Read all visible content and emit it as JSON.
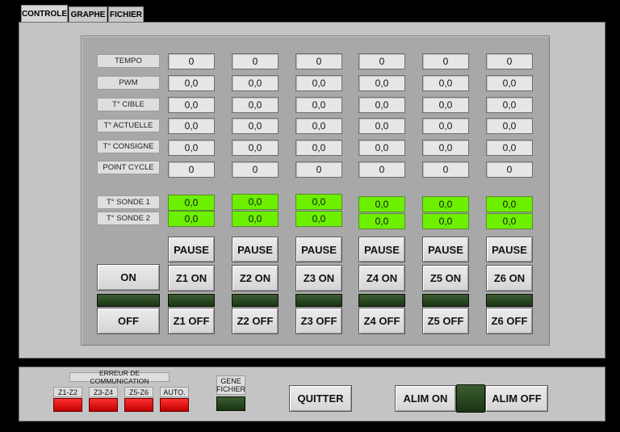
{
  "tabs": [
    {
      "label": "CONTROLE",
      "active": true
    },
    {
      "label": "GRAPHE"
    },
    {
      "label": "FICHIER"
    }
  ],
  "row_labels": [
    "TEMPO",
    "PWM",
    "T° CIBLE",
    "T° ACTUELLE",
    "T° CONSIGNE",
    "POINT CYCLE",
    "T° SONDE 1",
    "T° SONDE 2"
  ],
  "zones": [
    {
      "tempo": "0",
      "pwm": "0,0",
      "cible": "0,0",
      "actuelle": "0,0",
      "consigne": "0,0",
      "cycle": "0",
      "sonde1": "0,0",
      "sonde2": "0,0",
      "pause": "PAUSE",
      "on": "Z1 ON",
      "off": "Z1 OFF"
    },
    {
      "tempo": "0",
      "pwm": "0,0",
      "cible": "0,0",
      "actuelle": "0,0",
      "consigne": "0,0",
      "cycle": "0",
      "sonde1": "0,0",
      "sonde2": "0,0",
      "pause": "PAUSE",
      "on": "Z2 ON",
      "off": "Z2 OFF"
    },
    {
      "tempo": "0",
      "pwm": "0,0",
      "cible": "0,0",
      "actuelle": "0,0",
      "consigne": "0,0",
      "cycle": "0",
      "sonde1": "0,0",
      "sonde2": "0,0",
      "pause": "PAUSE",
      "on": "Z3 ON",
      "off": "Z3 OFF"
    },
    {
      "tempo": "0",
      "pwm": "0,0",
      "cible": "0,0",
      "actuelle": "0,0",
      "consigne": "0,0",
      "cycle": "0",
      "sonde1": "0,0",
      "sonde2": "0,0",
      "pause": "PAUSE",
      "on": "Z4 ON",
      "off": "Z4 OFF"
    },
    {
      "tempo": "0",
      "pwm": "0,0",
      "cible": "0,0",
      "actuelle": "0,0",
      "consigne": "0,0",
      "cycle": "0",
      "sonde1": "0,0",
      "sonde2": "0,0",
      "pause": "PAUSE",
      "on": "Z5 ON",
      "off": "Z5 OFF"
    },
    {
      "tempo": "0",
      "pwm": "0,0",
      "cible": "0,0",
      "actuelle": "0,0",
      "consigne": "0,0",
      "cycle": "0",
      "sonde1": "0,0",
      "sonde2": "0,0",
      "pause": "PAUSE",
      "on": "Z6 ON",
      "off": "Z6 OFF"
    }
  ],
  "master": {
    "on": "ON",
    "off": "OFF"
  },
  "comm": {
    "title": "ERREUR DE COMMUNICATION",
    "items": [
      "Z1-Z2",
      "Z3-Z4",
      "Z5-Z6",
      "AUTO."
    ]
  },
  "gene_fichier": "GENE FICHIER",
  "quit": "QUITTER",
  "alim": {
    "on": "ALIM ON",
    "off": "ALIM OFF"
  },
  "colors": {
    "probe_ok": "#6cf000",
    "led_off": "#2a4a22",
    "error": "#e00000"
  }
}
